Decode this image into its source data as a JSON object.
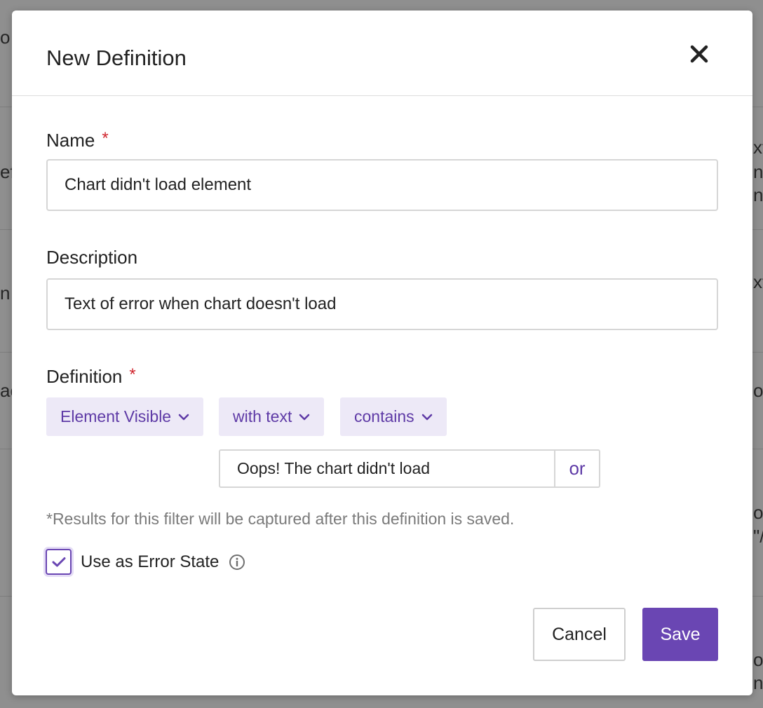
{
  "background": {
    "fragments": [
      "o",
      "ef",
      "n",
      "ac",
      "xt",
      "n",
      "n\"",
      "xt",
      "or",
      "or",
      "\"/",
      "or",
      "ns"
    ]
  },
  "modal": {
    "title": "New Definition",
    "close_icon": "close-icon",
    "fields": {
      "name": {
        "label": "Name",
        "required_mark": "*",
        "value": "Chart didn't load element"
      },
      "description": {
        "label": "Description",
        "value": "Text of error when chart doesn't load"
      },
      "definition": {
        "label": "Definition",
        "required_mark": "*",
        "selectors": {
          "type": "Element Visible",
          "match": "with text",
          "operator": "contains"
        },
        "value": "Oops! The chart didn't load",
        "or_label": "or"
      }
    },
    "note": "*Results for this filter will be captured after this definition is saved.",
    "error_state": {
      "label": "Use as Error State",
      "checked": true,
      "info_icon": "info-icon"
    },
    "buttons": {
      "cancel": "Cancel",
      "save": "Save"
    }
  },
  "colors": {
    "accent": "#6a46b3",
    "pill_bg": "#ede9f7",
    "required": "#d0262e",
    "overlay": "#8f8f8f"
  }
}
